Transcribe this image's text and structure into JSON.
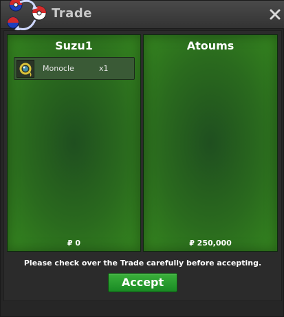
{
  "window": {
    "title": "Trade",
    "logo_icon": "pokeball-swap-icon",
    "close_icon": "close-icon"
  },
  "players": [
    {
      "name": "Suzu1",
      "items": [
        {
          "name": "Monocle",
          "quantity": "x1",
          "icon": "monocle-icon"
        }
      ],
      "money": "₽ 0"
    },
    {
      "name": "Atoums",
      "items": [],
      "money": "₽ 250,000"
    }
  ],
  "notice": "Please check over the Trade carefully before accepting.",
  "accept_label": "Accept",
  "colors": {
    "panel_green": "#2a6a1e",
    "accept_green": "#2a9a2f",
    "title_text": "#c8c8c8"
  }
}
